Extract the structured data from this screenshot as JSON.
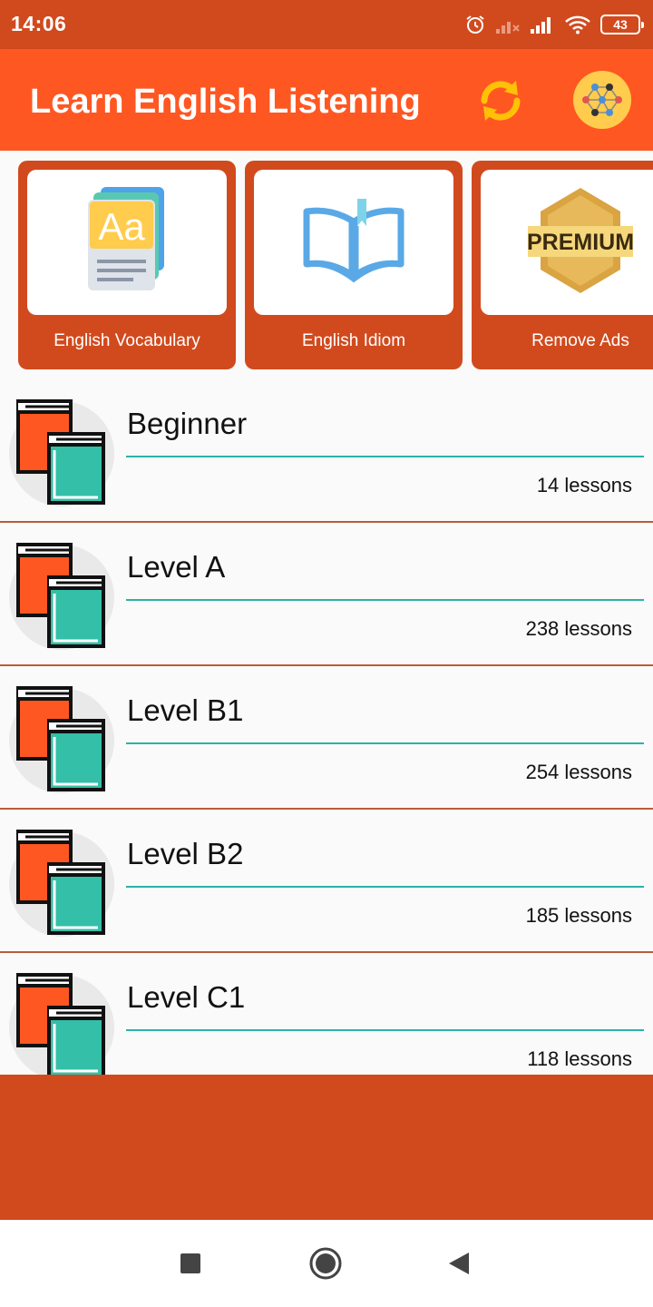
{
  "status_bar": {
    "time": "14:06",
    "battery": "43",
    "icons": [
      "alarm-icon",
      "signal-no-service-icon",
      "signal-icon",
      "wifi-icon",
      "battery-icon"
    ]
  },
  "app_bar": {
    "title": "Learn English Listening",
    "actions": [
      "sync-icon",
      "network-icon"
    ]
  },
  "cards": [
    {
      "label": "English Vocabulary",
      "icon": "vocabulary-cards-icon"
    },
    {
      "label": "English Idiom",
      "icon": "open-book-icon"
    },
    {
      "label": "Remove Ads",
      "icon": "premium-badge-icon",
      "badge_text": "PREMIUM"
    }
  ],
  "levels": [
    {
      "name": "Beginner",
      "count": "14 lessons"
    },
    {
      "name": "Level A",
      "count": "238 lessons"
    },
    {
      "name": "Level B1",
      "count": "254 lessons"
    },
    {
      "name": "Level B2",
      "count": "185 lessons"
    },
    {
      "name": "Level C1",
      "count": "118 lessons"
    }
  ],
  "nav": [
    "recents-square-icon",
    "home-circle-icon",
    "back-triangle-icon"
  ],
  "colors": {
    "status_bar": "#d14a1e",
    "app_bar": "#ff5722",
    "card": "#d14a1e",
    "divider": "#b85c3c",
    "accent_line": "#2bb3a6",
    "book_orange": "#ff5722",
    "book_teal": "#34bfa8"
  }
}
